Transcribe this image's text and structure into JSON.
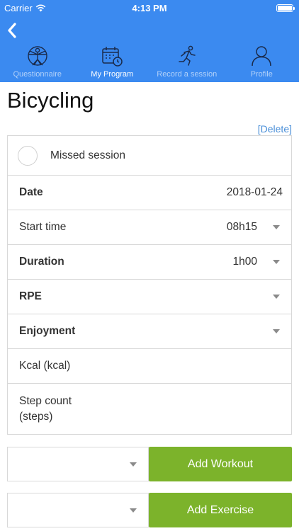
{
  "status_bar": {
    "carrier": "Carrier",
    "time": "4:13 PM"
  },
  "nav": {
    "tabs": [
      {
        "label": "Questionnaire",
        "icon": "vitruvian-man-icon"
      },
      {
        "label": "My Program",
        "icon": "calendar-clock-icon"
      },
      {
        "label": "Record a session",
        "icon": "runner-icon"
      },
      {
        "label": "Profile",
        "icon": "person-icon"
      }
    ],
    "active_tab": "My Program"
  },
  "page": {
    "title": "Bicycling",
    "delete_label": "[Delete]"
  },
  "form": {
    "missed_session": {
      "label": "Missed session",
      "checked": false
    },
    "date": {
      "label": "Date",
      "value": "2018-01-24"
    },
    "start_time": {
      "label": "Start time",
      "value": "08h15"
    },
    "duration": {
      "label": "Duration",
      "value": "1h00"
    },
    "rpe": {
      "label": "RPE",
      "value": ""
    },
    "enjoyment": {
      "label": "Enjoyment",
      "value": ""
    },
    "kcal": {
      "label": "Kcal (kcal)",
      "value": ""
    },
    "step_count": {
      "label_line1": "Step count",
      "label_line2": "(steps)",
      "value": ""
    }
  },
  "actions": {
    "add_workout": {
      "select_value": "",
      "button_label": "Add Workout"
    },
    "add_exercise": {
      "select_value": "",
      "button_label": "Add Exercise"
    }
  },
  "colors": {
    "header": "#3b8af0",
    "accent_button": "#7cb32b",
    "link": "#4a8fd8"
  }
}
